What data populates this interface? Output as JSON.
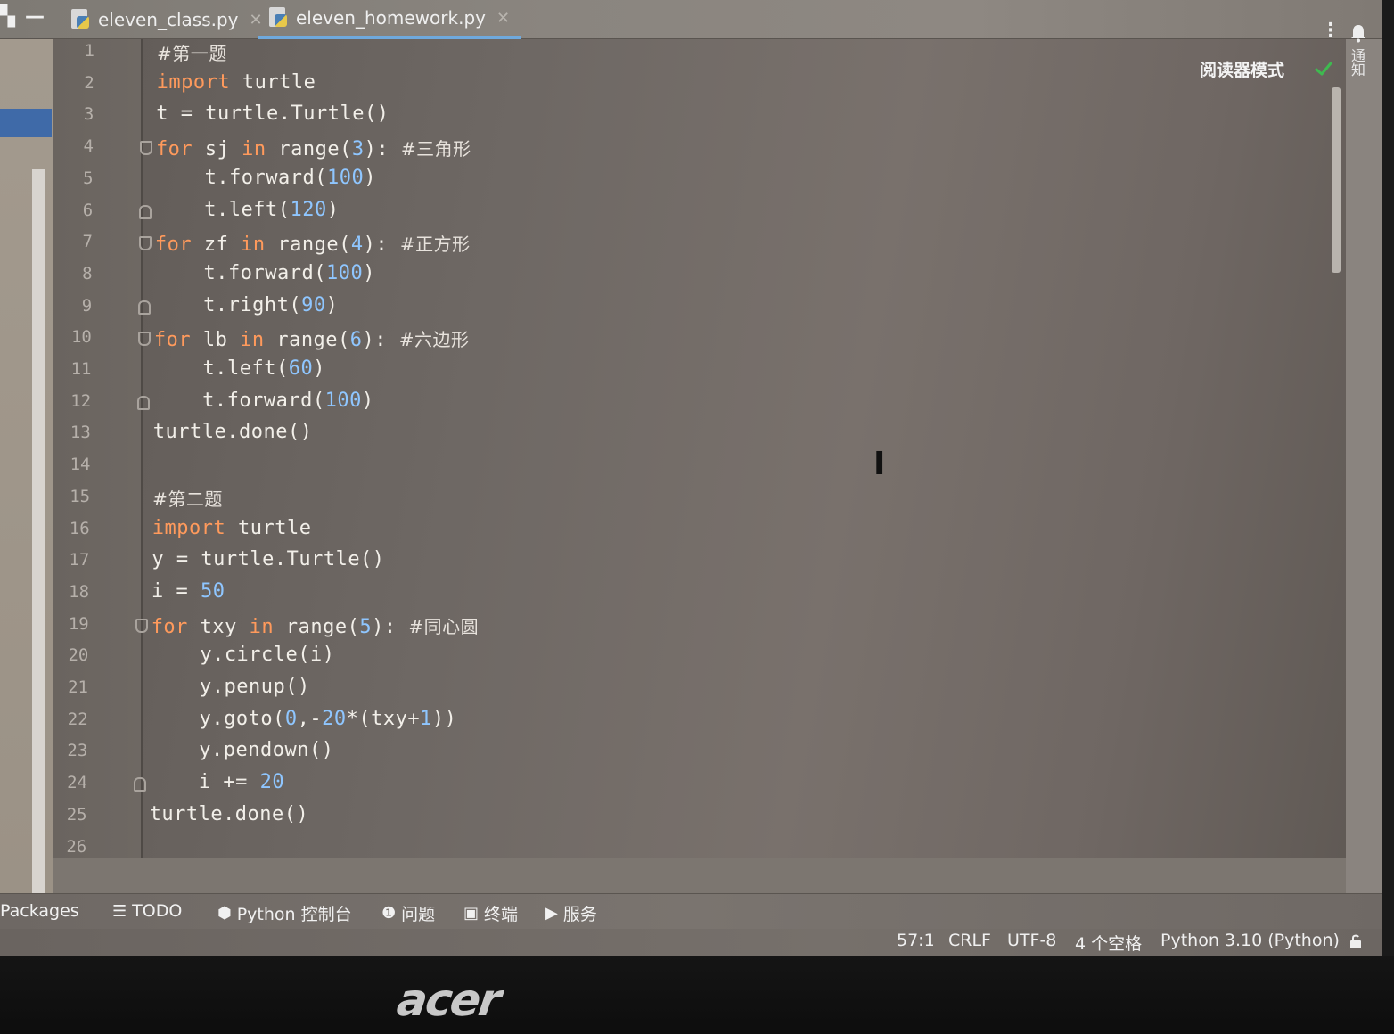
{
  "tabs": [
    {
      "label": "eleven_class.py",
      "active": false
    },
    {
      "label": "eleven_homework.py",
      "active": true
    }
  ],
  "window_controls": {
    "restore": "▚",
    "minimize": "—"
  },
  "editor": {
    "reader_mode": "阅读器模式",
    "lines": [
      {
        "no": "1",
        "segments": [
          {
            "t": "#第一题",
            "c": "cmt"
          }
        ]
      },
      {
        "no": "2",
        "segments": [
          {
            "t": "import",
            "c": "kw"
          },
          {
            "t": " turtle",
            "c": ""
          }
        ]
      },
      {
        "no": "3",
        "segments": [
          {
            "t": "t = turtle.Turtle()",
            "c": ""
          }
        ]
      },
      {
        "no": "4",
        "segments": [
          {
            "t": "for",
            "c": "kw"
          },
          {
            "t": " sj ",
            "c": ""
          },
          {
            "t": "in",
            "c": "kw"
          },
          {
            "t": " range(",
            "c": ""
          },
          {
            "t": "3",
            "c": "num"
          },
          {
            "t": "): ",
            "c": ""
          },
          {
            "t": "#三角形",
            "c": "cmt"
          }
        ]
      },
      {
        "no": "5",
        "segments": [
          {
            "t": "    t.forward(",
            "c": ""
          },
          {
            "t": "100",
            "c": "num"
          },
          {
            "t": ")",
            "c": ""
          }
        ]
      },
      {
        "no": "6",
        "segments": [
          {
            "t": "    t.left(",
            "c": ""
          },
          {
            "t": "120",
            "c": "num"
          },
          {
            "t": ")",
            "c": ""
          }
        ]
      },
      {
        "no": "7",
        "segments": [
          {
            "t": "for",
            "c": "kw"
          },
          {
            "t": " zf ",
            "c": ""
          },
          {
            "t": "in",
            "c": "kw"
          },
          {
            "t": " range(",
            "c": ""
          },
          {
            "t": "4",
            "c": "num"
          },
          {
            "t": "): ",
            "c": ""
          },
          {
            "t": "#正方形",
            "c": "cmt"
          }
        ]
      },
      {
        "no": "8",
        "segments": [
          {
            "t": "    t.forward(",
            "c": ""
          },
          {
            "t": "100",
            "c": "num"
          },
          {
            "t": ")",
            "c": ""
          }
        ]
      },
      {
        "no": "9",
        "segments": [
          {
            "t": "    t.right(",
            "c": ""
          },
          {
            "t": "90",
            "c": "num"
          },
          {
            "t": ")",
            "c": ""
          }
        ]
      },
      {
        "no": "10",
        "segments": [
          {
            "t": "for",
            "c": "kw"
          },
          {
            "t": " lb ",
            "c": ""
          },
          {
            "t": "in",
            "c": "kw"
          },
          {
            "t": " range(",
            "c": ""
          },
          {
            "t": "6",
            "c": "num"
          },
          {
            "t": "): ",
            "c": ""
          },
          {
            "t": "#六边形",
            "c": "cmt"
          }
        ]
      },
      {
        "no": "11",
        "segments": [
          {
            "t": "    t.left(",
            "c": ""
          },
          {
            "t": "60",
            "c": "num"
          },
          {
            "t": ")",
            "c": ""
          }
        ]
      },
      {
        "no": "12",
        "segments": [
          {
            "t": "    t.forward(",
            "c": ""
          },
          {
            "t": "100",
            "c": "num"
          },
          {
            "t": ")",
            "c": ""
          }
        ]
      },
      {
        "no": "13",
        "segments": [
          {
            "t": "turtle.done()",
            "c": ""
          }
        ]
      },
      {
        "no": "14",
        "segments": []
      },
      {
        "no": "15",
        "segments": [
          {
            "t": "#第二题",
            "c": "cmt"
          }
        ]
      },
      {
        "no": "16",
        "segments": [
          {
            "t": "import",
            "c": "kw"
          },
          {
            "t": " turtle",
            "c": ""
          }
        ]
      },
      {
        "no": "17",
        "segments": [
          {
            "t": "y = turtle.Turtle()",
            "c": ""
          }
        ]
      },
      {
        "no": "18",
        "segments": [
          {
            "t": "i = ",
            "c": ""
          },
          {
            "t": "50",
            "c": "num"
          }
        ]
      },
      {
        "no": "19",
        "segments": [
          {
            "t": "for",
            "c": "kw"
          },
          {
            "t": " txy ",
            "c": ""
          },
          {
            "t": "in",
            "c": "kw"
          },
          {
            "t": " range(",
            "c": ""
          },
          {
            "t": "5",
            "c": "num"
          },
          {
            "t": "): ",
            "c": ""
          },
          {
            "t": "#同心圆",
            "c": "cmt"
          }
        ]
      },
      {
        "no": "20",
        "segments": [
          {
            "t": "    y.circle(i)",
            "c": ""
          }
        ]
      },
      {
        "no": "21",
        "segments": [
          {
            "t": "    y.penup()",
            "c": ""
          }
        ]
      },
      {
        "no": "22",
        "segments": [
          {
            "t": "    y.goto(",
            "c": ""
          },
          {
            "t": "0",
            "c": "num"
          },
          {
            "t": ",-",
            "c": ""
          },
          {
            "t": "20",
            "c": "num"
          },
          {
            "t": "*(txy+",
            "c": ""
          },
          {
            "t": "1",
            "c": "num"
          },
          {
            "t": "))",
            "c": ""
          }
        ]
      },
      {
        "no": "23",
        "segments": [
          {
            "t": "    y.pendown()",
            "c": ""
          }
        ]
      },
      {
        "no": "24",
        "segments": [
          {
            "t": "    i += ",
            "c": ""
          },
          {
            "t": "20",
            "c": "num"
          }
        ]
      },
      {
        "no": "25",
        "segments": [
          {
            "t": "turtle.done()",
            "c": ""
          }
        ]
      },
      {
        "no": "26",
        "segments": []
      }
    ],
    "fold_starts": [
      "4",
      "7",
      "10",
      "19"
    ],
    "fold_ends": [
      "6",
      "9",
      "12",
      "24"
    ]
  },
  "right_panel": {
    "notifications_label": "通知"
  },
  "tool_windows": [
    {
      "label": "Packages",
      "icon": "packages-icon"
    },
    {
      "label": "TODO",
      "icon": "list-icon"
    },
    {
      "label": "Python 控制台",
      "icon": "python-console-icon"
    },
    {
      "label": "问题",
      "icon": "problems-icon"
    },
    {
      "label": "终端",
      "icon": "terminal-icon"
    },
    {
      "label": "服务",
      "icon": "services-icon"
    }
  ],
  "status": {
    "position": "57:1",
    "line_separator": "CRLF",
    "encoding": "UTF-8",
    "indent": "4 个空格",
    "interpreter": "Python 3.10 (Python)"
  },
  "monitor_brand": "acer",
  "colors": {
    "keyword": "#ff9a5c",
    "number": "#8fc6ff",
    "active_tab_underline": "#6fa9dd",
    "check": "#3fb950"
  }
}
